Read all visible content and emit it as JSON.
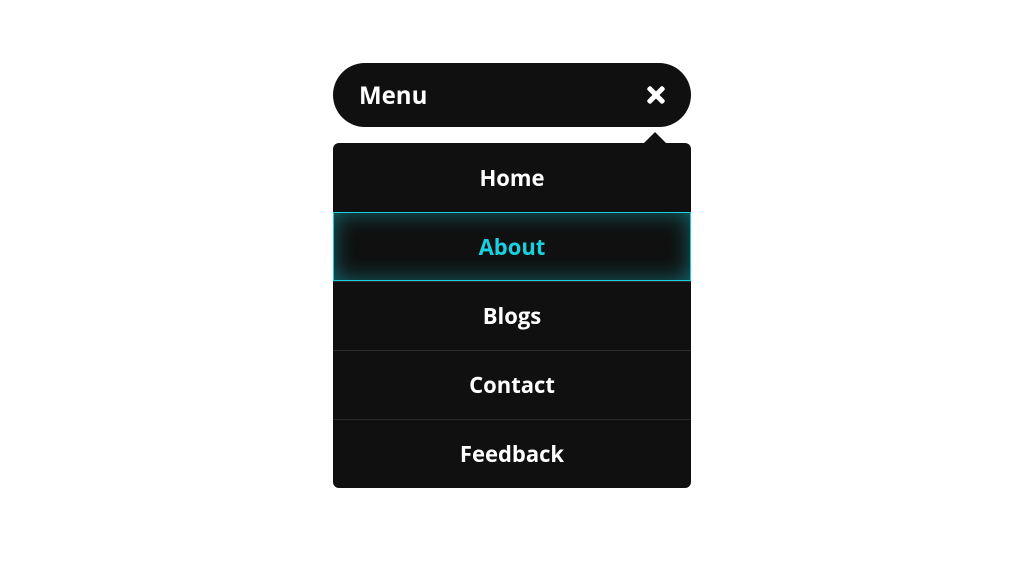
{
  "menu": {
    "toggle_label": "Menu",
    "items": [
      {
        "label": "Home"
      },
      {
        "label": "About"
      },
      {
        "label": "Blogs"
      },
      {
        "label": "Contact"
      },
      {
        "label": "Feedback"
      }
    ],
    "active_index": 1
  },
  "colors": {
    "panel": "#101010",
    "accent": "#17d0e0",
    "text": "#ffffff"
  }
}
